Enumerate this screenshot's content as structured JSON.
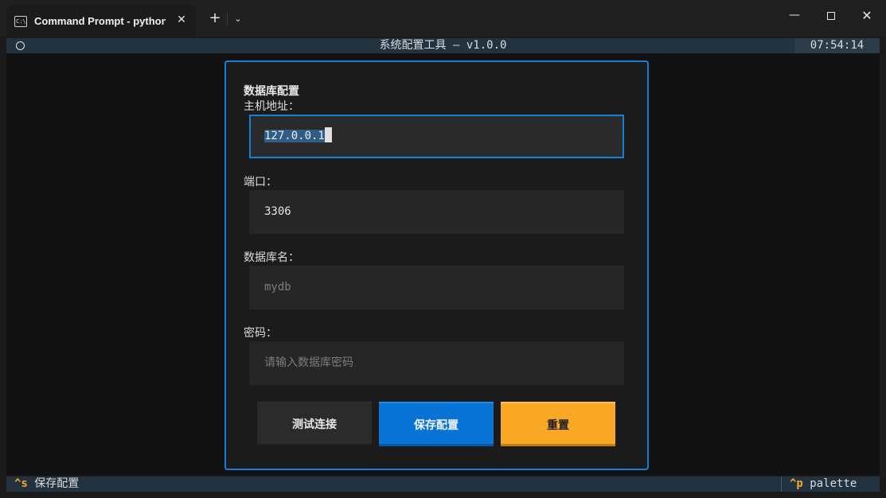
{
  "window": {
    "tab_title": "Command Prompt - python r",
    "tab_icon_text": "C:\\",
    "new_tab_glyph": "+",
    "dropdown_glyph": "⌄",
    "minimize_glyph": "—",
    "close_glyph": "✕",
    "tab_close_glyph": "✕"
  },
  "header": {
    "title": "系统配置工具 — v1.0.0",
    "clock": "07:54:14"
  },
  "form": {
    "section_title": "数据库配置",
    "host": {
      "label": "主机地址：",
      "value": "127.0.0.1"
    },
    "port": {
      "label": "端口：",
      "value": "3306"
    },
    "dbname": {
      "label": "数据库名：",
      "placeholder": "mydb"
    },
    "password": {
      "label": "密码：",
      "placeholder": "请输入数据库密码"
    }
  },
  "buttons": {
    "test": "测试连接",
    "save": "保存配置",
    "reset": "重置"
  },
  "footer": {
    "save_key": "^s",
    "save_label": "保存配置",
    "palette_key": "^p",
    "palette_label": "palette"
  },
  "colors": {
    "accent": "#1a7fd4",
    "primary_button": "#0a74d6",
    "warning_button": "#f9a826"
  }
}
